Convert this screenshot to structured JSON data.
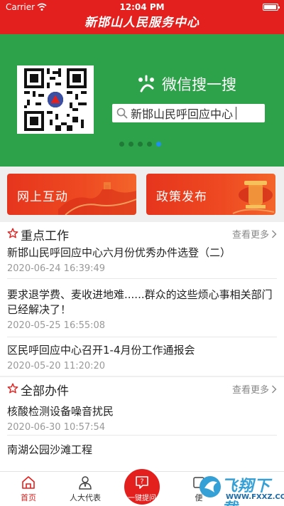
{
  "status_bar": {
    "carrier": "Carrier",
    "time": "12:04 PM"
  },
  "app": {
    "title": "新邯山人民服务中心"
  },
  "banner": {
    "wechat_label": "微信搜一搜",
    "search_text": "新邯山民呼回应中心",
    "page_index": 5,
    "page_count": 5,
    "color": "#2ea24a"
  },
  "quick_actions": [
    {
      "label": "网上互动"
    },
    {
      "label": "政策发布"
    }
  ],
  "sections": {
    "key_work": {
      "title": "重点工作",
      "more": "查看更多",
      "items": [
        {
          "title": "新邯山民呼回应中心六月份优秀办件选登（二）",
          "date": "2020-06-24 16:39:49"
        },
        {
          "title": "要求退学费、麦收进地难......群众的这些烦心事相关部门已经解决了！",
          "date": "2020-05-25 16:55:08"
        },
        {
          "title": "区民呼回应中心召开1-4月份工作通报会",
          "date": "2020-05-20 11:20:20"
        }
      ]
    },
    "all_cases": {
      "title": "全部办件",
      "more": "查看更多",
      "items": [
        {
          "title": "核酸检测设备噪音扰民",
          "date": "2020-06-30 10:57:54"
        },
        {
          "title": "南湖公园沙滩工程",
          "date": ""
        }
      ]
    }
  },
  "tabbar": {
    "home": "首页",
    "rep": "人大代表",
    "ask": "一键提问",
    "fourth": "便"
  },
  "watermark": {
    "text": "飞翔下载",
    "url": "WWW.FXXZ.COM"
  },
  "colors": {
    "brand_red": "#e4201e",
    "accent_blue": "#1f8ff0"
  }
}
